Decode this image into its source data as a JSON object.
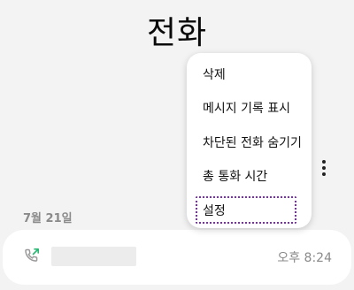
{
  "header": {
    "title": "전화"
  },
  "toolbar": {
    "more_icon": "more-vertical-icon"
  },
  "menu": {
    "items": [
      {
        "label": "삭제"
      },
      {
        "label": "메시지 기록 표시"
      },
      {
        "label": "차단된 전화 숨기기"
      },
      {
        "label": "총 통화 시간"
      },
      {
        "label": "설정",
        "focused": true
      }
    ]
  },
  "call_log": {
    "date_header": "7월 21일",
    "entries": [
      {
        "type_icon": "outgoing-call-icon",
        "time": "오후 8:24"
      }
    ]
  },
  "colors": {
    "background": "#f3f3f3",
    "focus_outline": "#7b2fb0",
    "outgoing_arrow": "#2bb673"
  }
}
